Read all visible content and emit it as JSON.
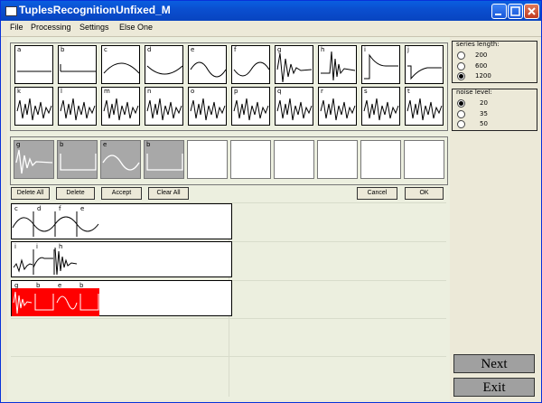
{
  "window": {
    "title": "TuplesRecognitionUnfixed_M"
  },
  "menu": [
    "File",
    "Processing",
    "Settings",
    "Else One"
  ],
  "patterns_row1": [
    "a",
    "b",
    "c",
    "d",
    "e",
    "f",
    "g",
    "h",
    "i",
    "j"
  ],
  "patterns_row2": [
    "k",
    "l",
    "m",
    "n",
    "o",
    "p",
    "q",
    "r",
    "s",
    "t"
  ],
  "selected": [
    "g",
    "b",
    "e",
    "b"
  ],
  "buttons": {
    "delete_all": "Delete All",
    "delete": "Delete",
    "accept": "Accept",
    "clear_all": "Clear All",
    "cancel": "Cancel",
    "ok": "OK"
  },
  "results": [
    {
      "labels": [
        "c",
        "d",
        "f",
        "e"
      ]
    },
    {
      "labels": [
        "i",
        "i",
        "h"
      ]
    },
    {
      "labels": [
        "g",
        "b",
        "e",
        "b"
      ]
    }
  ],
  "series_length": {
    "title": "series length:",
    "options": [
      "200",
      "600",
      "1200"
    ],
    "selected": "1200"
  },
  "noise_level": {
    "title": "noise level:",
    "options": [
      "20",
      "35",
      "50"
    ],
    "selected": "20"
  },
  "nav": {
    "next": "Next",
    "exit": "Exit"
  },
  "colors": {
    "title_bar": "#0a4fd0",
    "highlight": "#ff0000",
    "selected_tile": "#a8a8a8"
  }
}
